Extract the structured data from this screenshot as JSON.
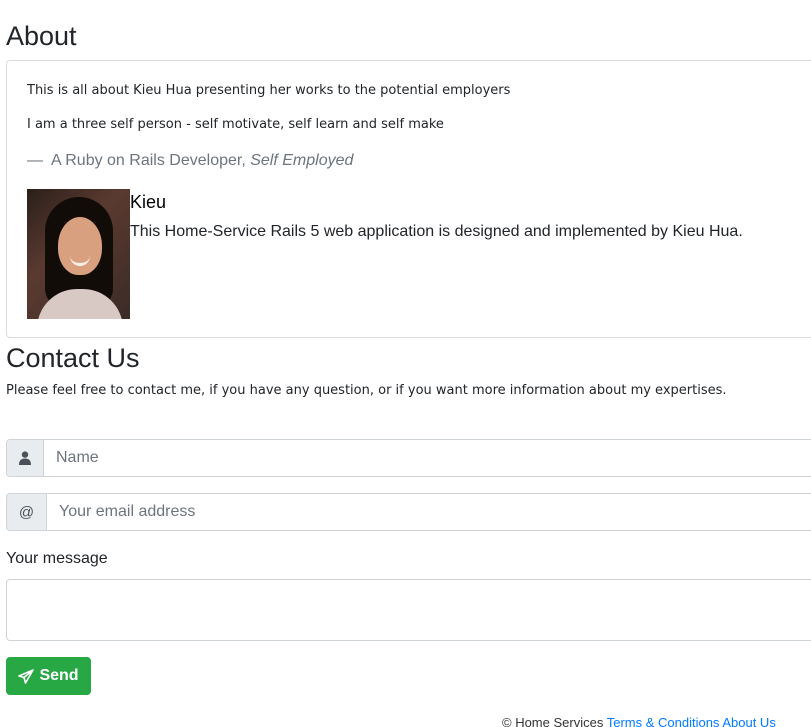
{
  "about": {
    "heading": "About",
    "line1": "This is all about Kieu Hua presenting her works to the potential employers",
    "line2": "I am a three self person - self motivate, self learn and self make",
    "quote_dash": "—",
    "quote_role": "A Ruby on Rails Developer,",
    "quote_employer": "Self Employed",
    "profile": {
      "name": "Kieu",
      "description": "This Home-Service Rails 5 web application is designed and implemented by Kieu Hua."
    }
  },
  "contact": {
    "heading": "Contact Us",
    "intro": "Please feel free to contact me, if you have any question, or if you want more information about my expertises.",
    "name_placeholder": "Name",
    "email_addon": "@",
    "email_placeholder": "Your email address",
    "message_label": "Your message",
    "send_label": "Send"
  },
  "footer": {
    "copyright": "© Home Services",
    "links": [
      "Terms & Conditions",
      "About Us"
    ]
  },
  "icons": {
    "name_addon": "user-icon",
    "send": "paper-plane-icon"
  },
  "colors": {
    "send_button": "#28a745",
    "link": "#007bff",
    "muted": "#6c757d"
  }
}
